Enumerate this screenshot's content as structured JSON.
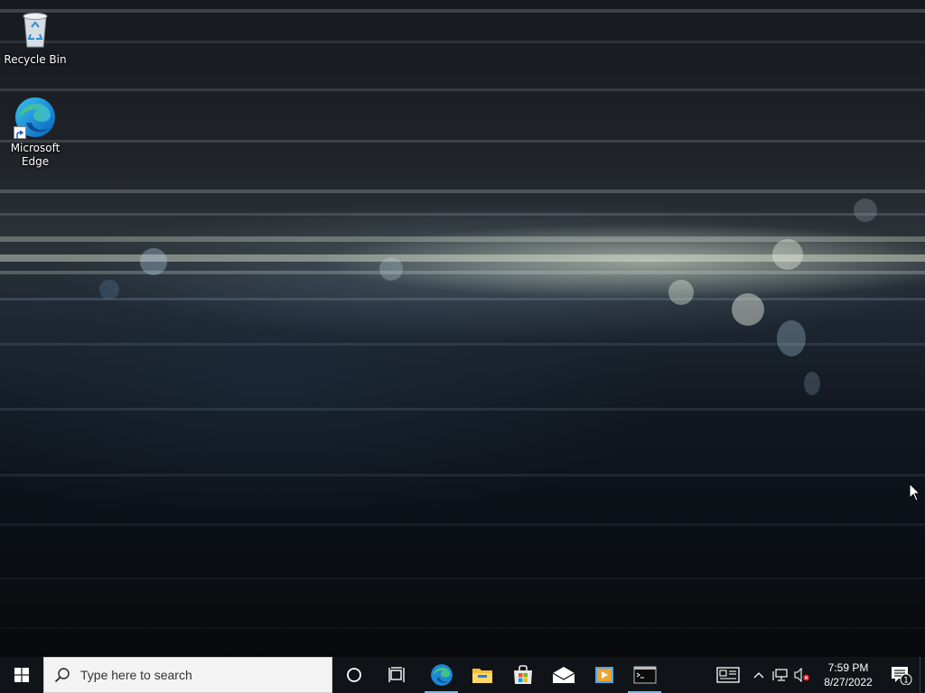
{
  "desktop": {
    "icons": [
      {
        "label": "Recycle Bin",
        "icon": "recycle-bin-icon"
      },
      {
        "label": "Microsoft\nEdge",
        "icon": "edge-icon"
      }
    ]
  },
  "taskbar": {
    "start_icon": "windows-logo-icon",
    "search": {
      "placeholder": "Type here to search",
      "icon": "search-icon"
    },
    "pinned": [
      {
        "name": "cortana",
        "icon": "cortana-circle-icon"
      },
      {
        "name": "task-view",
        "icon": "task-view-icon"
      },
      {
        "name": "edge",
        "icon": "edge-icon",
        "active": true
      },
      {
        "name": "file-explorer",
        "icon": "folder-icon"
      },
      {
        "name": "microsoft-store",
        "icon": "store-bag-icon"
      },
      {
        "name": "mail",
        "icon": "mail-envelope-icon"
      },
      {
        "name": "media-player",
        "icon": "media-player-icon"
      },
      {
        "name": "command-prompt",
        "icon": "terminal-icon",
        "active": true
      }
    ],
    "tray": {
      "news_icon": "news-widget-icon",
      "overflow_icon": "chevron-up-icon",
      "network_icon": "network-icon",
      "volume_icon": "volume-muted-icon"
    },
    "clock": {
      "time": "7:59 PM",
      "date": "8/27/2022"
    },
    "notifications": {
      "icon": "notification-icon",
      "count": "1"
    }
  },
  "colors": {
    "taskbar_bg": "#101418",
    "active_indicator": "#76b9ed",
    "search_bg": "#f3f3f3"
  }
}
